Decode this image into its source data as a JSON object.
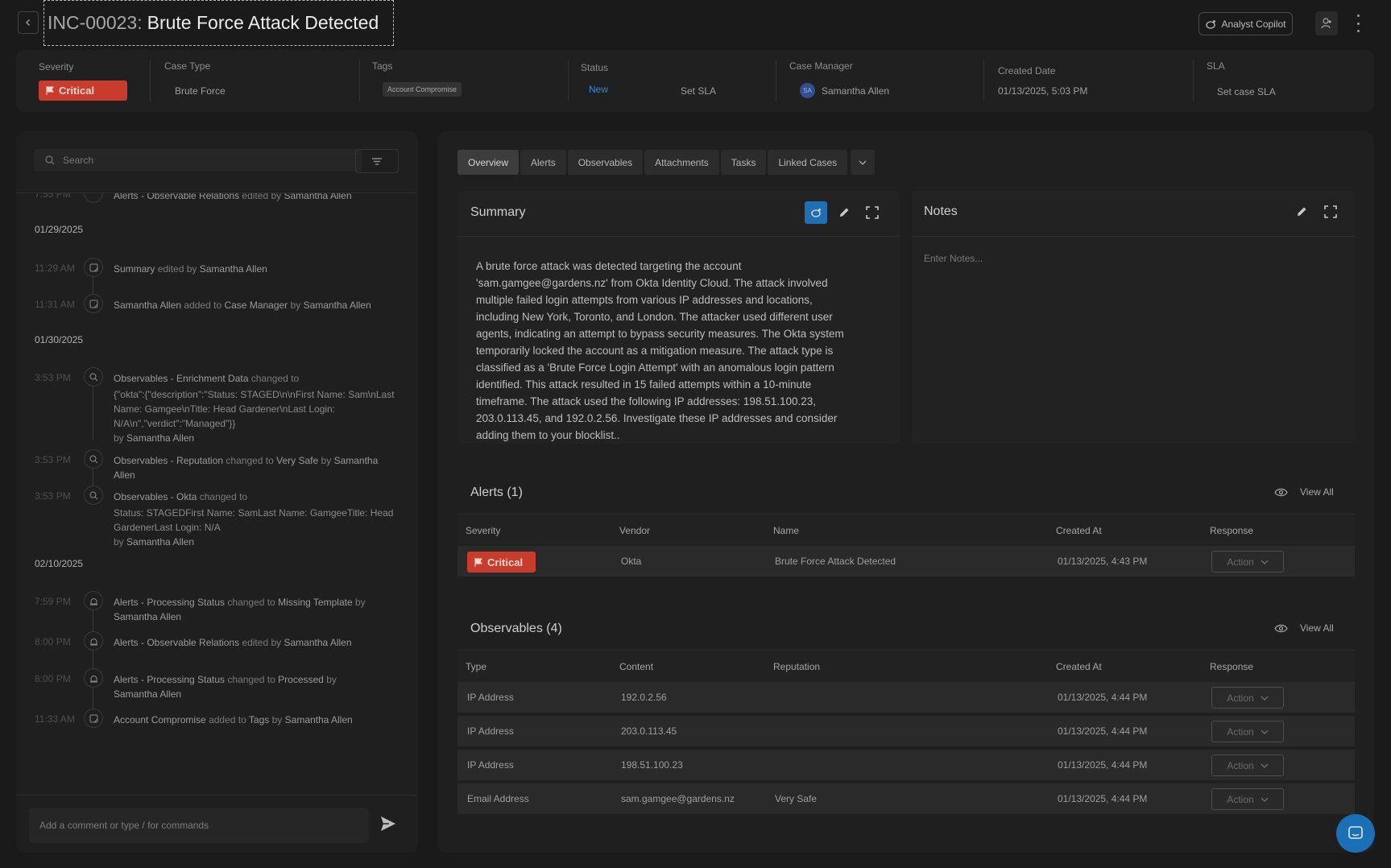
{
  "header": {
    "incident_id": "INC-00023:",
    "incident_name": "Brute Force Attack Detected",
    "copilot_label": "Analyst Copilot"
  },
  "meta": {
    "severity_label": "Severity",
    "severity_value": "Critical",
    "case_type_label": "Case Type",
    "case_type_value": "Brute Force",
    "tags_label": "Tags",
    "tag_value": "Account Compromise",
    "status_label": "Status",
    "status_value": "New",
    "set_sla_label": "Set SLA",
    "case_manager_label": "Case Manager",
    "case_manager_initials": "SA",
    "case_manager_value": "Samantha Allen",
    "created_date_label": "Created Date",
    "created_date_value": "01/13/2025, 5:03 PM",
    "sla_label": "SLA",
    "sla_value": "Set case SLA",
    "colors": {
      "critical": "#c73c2c",
      "status_new": "#2f86d6",
      "accent": "#1f6fb2"
    }
  },
  "left": {
    "search_placeholder": "Search",
    "top_partial": {
      "time": "7:55 PM",
      "subject": "Alerts - Observable Relations",
      "action": "edited by",
      "user": "Samantha Allen"
    },
    "dates": [
      "01/29/2025",
      "01/30/2025",
      "02/10/2025"
    ],
    "events": [
      {
        "time": "11:29 AM",
        "subject": "Summary",
        "action": "edited by",
        "user": "Samantha Allen",
        "icon": "note-icon"
      },
      {
        "time": "11:31 AM",
        "subject": "Samantha Allen",
        "action": "added to",
        "target": "Case Manager",
        "by": "by",
        "user": "Samantha Allen",
        "icon": "note-icon"
      },
      {
        "time": "3:53 PM",
        "subject": "Observables - Enrichment Data",
        "action": "changed to",
        "detail": "{\"okta\":{\"description\":\"Status: STAGED\\n\\nFirst Name: Sam\\nLast Name: Gamgee\\nTitle: Head Gardener\\nLast Login: N/A\\n\",\"verdict\":\"Managed\"}}",
        "by": "by",
        "user": "Samantha Allen",
        "icon": "search-icon"
      },
      {
        "time": "3:53 PM",
        "subject": "Observables - Reputation",
        "action": "changed to",
        "target": "Very Safe",
        "by": "by",
        "user": "Samantha Allen",
        "icon": "search-icon"
      },
      {
        "time": "3:53 PM",
        "subject": "Observables - Okta",
        "action": "changed to",
        "detail": "Status: STAGEDFirst Name: SamLast Name: GamgeeTitle: Head GardenerLast Login: N/A",
        "by": "by",
        "user": "Samantha Allen",
        "icon": "search-icon"
      },
      {
        "time": "7:59 PM",
        "subject": "Alerts - Processing Status",
        "action": "changed to",
        "target": "Missing Template",
        "by": "by",
        "user": "Samantha Allen",
        "icon": "alarm-icon"
      },
      {
        "time": "8:00 PM",
        "subject": "Alerts - Observable Relations",
        "action": "edited by",
        "user": "Samantha Allen",
        "icon": "alarm-icon"
      },
      {
        "time": "8:00 PM",
        "subject": "Alerts - Processing Status",
        "action": "changed to",
        "target": "Processed",
        "by": "by",
        "user": "Samantha Allen",
        "icon": "alarm-icon"
      },
      {
        "time": "11:33 AM",
        "subject": "Account Compromise",
        "action": "added to",
        "target": "Tags",
        "by": "by",
        "user": "Samantha Allen",
        "icon": "note-icon"
      }
    ],
    "comment_placeholder": "Add a comment or type / for commands"
  },
  "tabs": [
    "Overview",
    "Alerts",
    "Observables",
    "Attachments",
    "Tasks",
    "Linked Cases"
  ],
  "summary": {
    "title": "Summary",
    "text": "A brute force attack was detected targeting the account 'sam.gamgee@gardens.nz' from Okta Identity Cloud. The attack involved multiple failed login attempts from various IP addresses and locations, including New York, Toronto, and London. The attacker used different user agents, indicating an attempt to bypass security measures.  The Okta system temporarily locked the account as a mitigation measure. The attack type is classified as a 'Brute Force Login Attempt' with an anomalous login pattern identified. This attack resulted in 15 failed attempts within a 10-minute timeframe.  The attack used the following IP addresses: 198.51.100.23, 203.0.113.45, and 192.0.2.56.  Investigate these IP addresses and consider adding them to your blocklist.."
  },
  "notes": {
    "title": "Notes",
    "placeholder": "Enter Notes..."
  },
  "alerts": {
    "title": "Alerts (1)",
    "view_all": "View All",
    "columns": [
      "Severity",
      "Vendor",
      "Name",
      "Created At",
      "Response"
    ],
    "rows": [
      {
        "severity": "Critical",
        "vendor": "Okta",
        "name": "Brute Force Attack Detected",
        "created_at": "01/13/2025, 4:43 PM",
        "action": "Action"
      }
    ]
  },
  "observables": {
    "title": "Observables (4)",
    "view_all": "View All",
    "columns": [
      "Type",
      "Content",
      "Reputation",
      "Created At",
      "Response"
    ],
    "rows": [
      {
        "type": "IP Address",
        "content": "192.0.2.56",
        "reputation": "",
        "created_at": "01/13/2025, 4:44 PM",
        "action": "Action"
      },
      {
        "type": "IP Address",
        "content": "203.0.113.45",
        "reputation": "",
        "created_at": "01/13/2025, 4:44 PM",
        "action": "Action"
      },
      {
        "type": "IP Address",
        "content": "198.51.100.23",
        "reputation": "",
        "created_at": "01/13/2025, 4:44 PM",
        "action": "Action"
      },
      {
        "type": "Email Address",
        "content": "sam.gamgee@gardens.nz",
        "reputation": "Very Safe",
        "created_at": "01/13/2025, 4:44 PM",
        "action": "Action"
      }
    ]
  }
}
